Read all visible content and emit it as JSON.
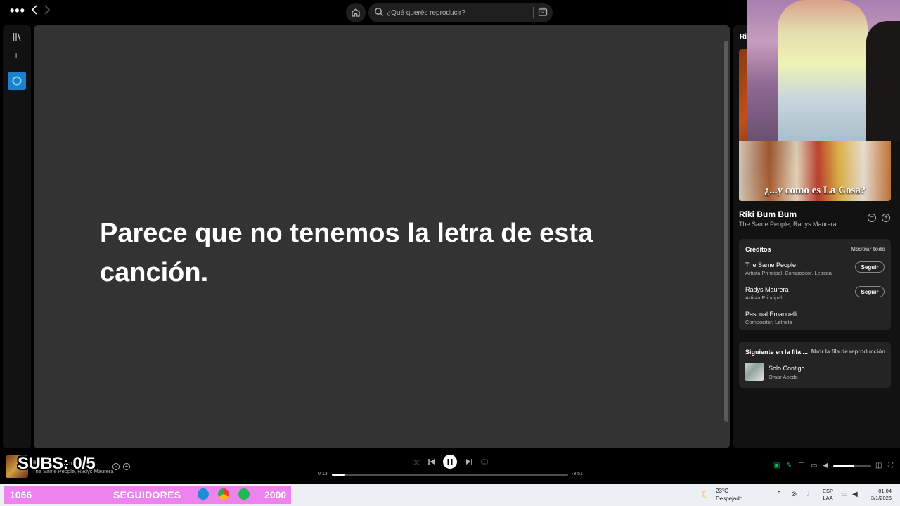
{
  "topbar": {
    "search_placeholder": "¿Qué querés reproducir?"
  },
  "main": {
    "no_lyrics_message": "Parece que no tenemos la letra de esta canción."
  },
  "right_panel": {
    "title": "Rik",
    "cover_caption": "¿...y como es La Cosa?",
    "song_title": "Riki Bum Bum",
    "song_artists": "The Same People, Radys Maurera",
    "credits": {
      "title": "Créditos",
      "show_all": "Mostrar todo",
      "items": [
        {
          "name": "The Same People",
          "role": "Artista Principal, Compositor, Letrista",
          "button": "Seguir"
        },
        {
          "name": "Radys Maurera",
          "role": "Artista Principal",
          "button": "Seguir"
        },
        {
          "name": "Pascual Emanuelli",
          "role": "Compositor, Letrista"
        }
      ]
    },
    "queue": {
      "title": "Siguiente en la fila ...",
      "open_link": "Abrir la fila de reproducción",
      "next": {
        "name": "Solo Contigo",
        "artist": "Omar Acedo"
      }
    }
  },
  "player": {
    "now_playing_title": "Riki Bum Bum",
    "now_playing_artist": "The Same People, Radys Maurera",
    "subs_overlay": "SUBS: 0/5",
    "elapsed": "0:13",
    "remaining": "-3:51",
    "progress_fraction": 0.055,
    "volume_fraction": 0.55
  },
  "taskbar": {
    "followers_count": "1066",
    "followers_label": "SEGUIDORES",
    "followers_goal": "2000",
    "weather_temp": "23°C",
    "weather_desc": "Despejado",
    "lang_1": "ESP",
    "lang_2": "LAA",
    "time": "01:04",
    "date": "3/1/2026"
  },
  "colors": {
    "main_bg": "#333333",
    "accent_green": "#1db954",
    "stream_bar": "#ee82ee"
  }
}
